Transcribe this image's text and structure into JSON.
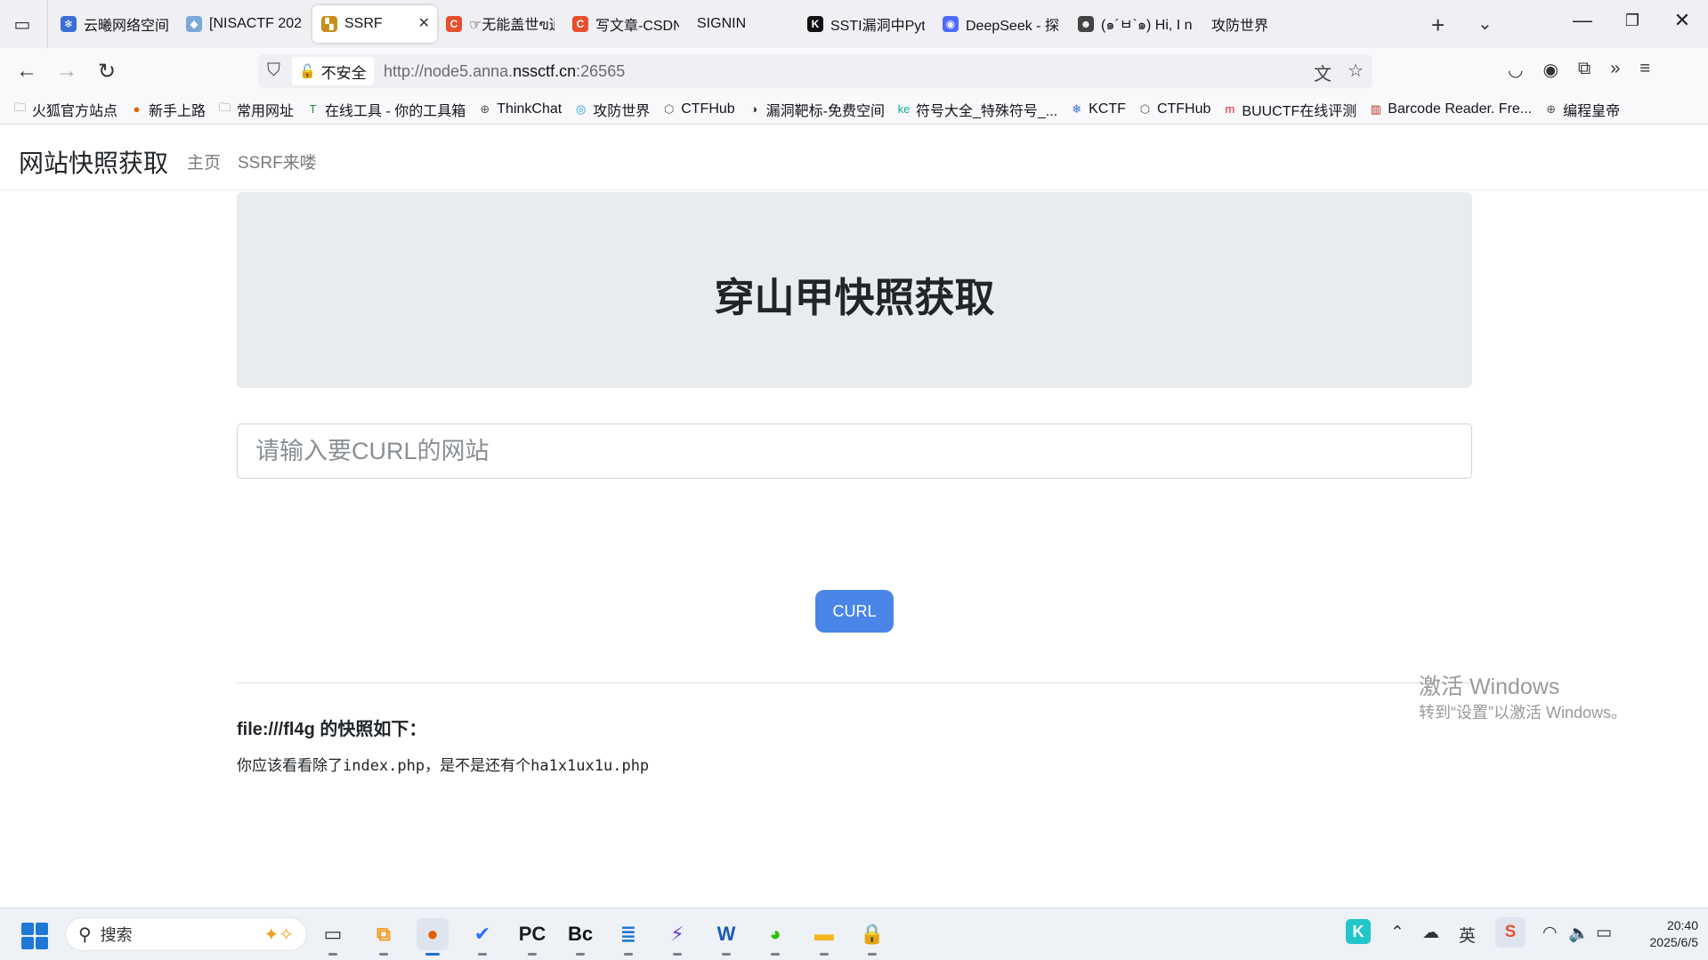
{
  "browser": {
    "tabs": [
      {
        "title": "云曦网络空间安",
        "color": "#3b6fd4",
        "glyph": "❄"
      },
      {
        "title": "[NISACTF 202",
        "color": "#7aa8d8",
        "glyph": "◆"
      },
      {
        "title": "SSRF",
        "color": "#c8901a",
        "glyph": "▚",
        "active": true
      },
      {
        "title": "☞无能盖世ฃ逍",
        "color": "#e8502d",
        "glyph": "C"
      },
      {
        "title": "写文章-CSDN",
        "color": "#e8502d",
        "glyph": "C"
      },
      {
        "title": "SIGNIN",
        "color": "",
        "glyph": ""
      },
      {
        "title": "SSTI漏洞中Pyt",
        "color": "#111111",
        "glyph": "K"
      },
      {
        "title": "DeepSeek - 探",
        "color": "#4d6bfe",
        "glyph": "◉"
      },
      {
        "title": "(๑´ㅂ`๑) Hi, I n",
        "color": "#444444",
        "glyph": "☻"
      },
      {
        "title": "攻防世界",
        "color": "",
        "glyph": ""
      }
    ],
    "address": {
      "security_label": "不安全",
      "url_prefix": "http://node5.anna.",
      "url_domain": "nssctf.cn",
      "url_suffix": ":26565"
    },
    "bookmarks": [
      {
        "label": "火狐官方站点",
        "icon": "folder-icon",
        "glyph": "🗀",
        "color": "#555"
      },
      {
        "label": "新手上路",
        "icon": "firefox-icon",
        "glyph": "●",
        "color": "#e66000"
      },
      {
        "label": "常用网址",
        "icon": "folder-icon",
        "glyph": "🗀",
        "color": "#555"
      },
      {
        "label": "在线工具 - 你的工具箱",
        "icon": "toolbox-icon",
        "glyph": "T",
        "color": "#2a8a4a"
      },
      {
        "label": "ThinkChat",
        "icon": "globe-icon",
        "glyph": "⊕",
        "color": "#555"
      },
      {
        "label": "攻防世界",
        "icon": "adworld-icon",
        "glyph": "◎",
        "color": "#1a9ad6"
      },
      {
        "label": "CTFHub",
        "icon": "ctfhub-icon",
        "glyph": "⬡",
        "color": "#555"
      },
      {
        "label": "漏洞靶标-免费空间",
        "icon": "target-icon",
        "glyph": "◑",
        "color": "#333"
      },
      {
        "label": "符号大全_特殊符号_...",
        "icon": "ke-icon",
        "glyph": "ke",
        "color": "#12a89d"
      },
      {
        "label": "KCTF",
        "icon": "snowflake-icon",
        "glyph": "❄",
        "color": "#3b6fd4"
      },
      {
        "label": "CTFHub",
        "icon": "ctfhub-icon",
        "glyph": "⬡",
        "color": "#555"
      },
      {
        "label": "BUUCTF在线评测",
        "icon": "buuctf-icon",
        "glyph": "m",
        "color": "#d23"
      },
      {
        "label": "Barcode Reader. Fre...",
        "icon": "barcode-icon",
        "glyph": "▥",
        "color": "#b5311c"
      },
      {
        "label": "编程皇帝",
        "icon": "globe-icon",
        "glyph": "⊕",
        "color": "#555"
      }
    ]
  },
  "site": {
    "brand": "网站快照获取",
    "nav": [
      "主页",
      "SSRF来喽"
    ],
    "hero_title": "穿山甲快照获取",
    "input_placeholder": "请输入要CURL的网站",
    "submit_label": "CURL",
    "result_title": "file:///fl4g 的快照如下：",
    "result_body": "你应该看看除了index.php，是不是还有个ha1x1ux1u.php"
  },
  "watermark": {
    "line1": "激活 Windows",
    "line2": "转到“设置”以激活 Windows。"
  },
  "taskbar": {
    "search_label": "搜索",
    "apps": [
      {
        "name": "task-view-icon",
        "glyph": "▭",
        "color": "#333"
      },
      {
        "name": "remote-desktop-icon",
        "glyph": "⧉",
        "color": "#f29a1a"
      },
      {
        "name": "firefox-icon",
        "glyph": "●",
        "color": "#e66000",
        "active": true
      },
      {
        "name": "feishu-icon",
        "glyph": "✔",
        "color": "#3370ff"
      },
      {
        "name": "pycharm-icon",
        "glyph": "PC",
        "color": "#1c1c1c"
      },
      {
        "name": "burpsuite-icon",
        "glyph": "Bc",
        "color": "#111"
      },
      {
        "name": "notepad-icon",
        "glyph": "≣",
        "color": "#1f78d8"
      },
      {
        "name": "visual-studio-icon",
        "glyph": "⚡",
        "color": "#6b3fd6"
      },
      {
        "name": "word-icon",
        "glyph": "W",
        "color": "#185abd"
      },
      {
        "name": "wechat-icon",
        "glyph": "◕",
        "color": "#2dc100"
      },
      {
        "name": "file-explorer-icon",
        "glyph": "▬",
        "color": "#f2b720"
      },
      {
        "name": "vpn-icon",
        "glyph": "🔒",
        "color": "#2b62c8"
      }
    ],
    "time": "20:40",
    "date": "2025/6/5"
  }
}
